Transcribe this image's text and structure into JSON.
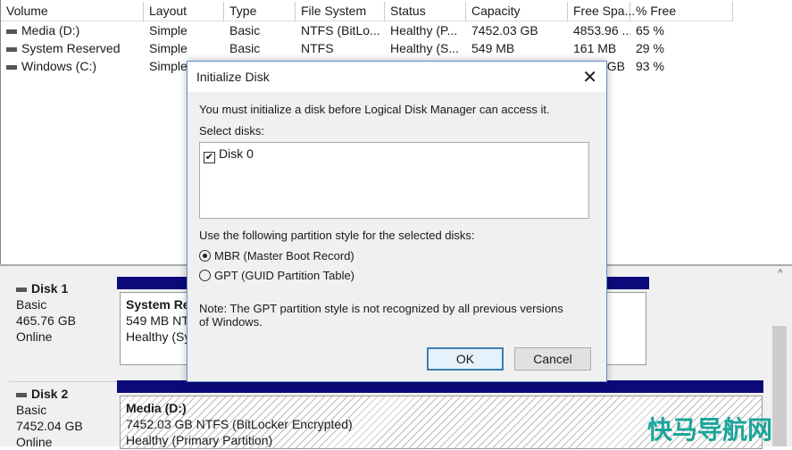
{
  "volumes": {
    "columns": [
      "Volume",
      "Layout",
      "Type",
      "File System",
      "Status",
      "Capacity",
      "Free Spa...",
      "% Free"
    ],
    "rows": [
      {
        "volume": "Media (D:)",
        "layout": "Simple",
        "type": "Basic",
        "fs": "NTFS (BitLo...",
        "status": "Healthy (P...",
        "capacity": "7452.03 GB",
        "free": "4853.96 ...",
        "pct": "65 %"
      },
      {
        "volume": "System Reserved",
        "layout": "Simple",
        "type": "Basic",
        "fs": "NTFS",
        "status": "Healthy (S...",
        "capacity": "549 MB",
        "free": "161 MB",
        "pct": "29 %"
      },
      {
        "volume": "Windows (C:)",
        "layout": "Simple",
        "type": "",
        "fs": "",
        "status": "",
        "capacity": "",
        "free": "GB",
        "pct": "93 %"
      }
    ]
  },
  "disks": [
    {
      "name": "Disk 1",
      "type": "Basic",
      "size": "465.76 GB",
      "state": "Online",
      "partition": {
        "name": "System Re",
        "line2": "549 MB NT",
        "line3": "Healthy (Sy"
      },
      "right_fragment": ")"
    },
    {
      "name": "Disk 2",
      "type": "Basic",
      "size": "7452.04 GB",
      "state": "Online",
      "partition": {
        "name": "Media  (D:)",
        "line2": "7452.03 GB NTFS (BitLocker Encrypted)",
        "line3": "Healthy (Primary Partition)"
      }
    }
  ],
  "dialog": {
    "title": "Initialize Disk",
    "intro": "You must initialize a disk before Logical Disk Manager can access it.",
    "select_label": "Select disks:",
    "disks": [
      {
        "label": "Disk 0",
        "checked": true
      }
    ],
    "style_label": "Use the following partition style for the selected disks:",
    "options": [
      {
        "label": "MBR (Master Boot Record)",
        "selected": true
      },
      {
        "label": "GPT (GUID Partition Table)",
        "selected": false
      }
    ],
    "note": "Note: The GPT partition style is not recognized by all previous versions of Windows.",
    "ok": "OK",
    "cancel": "Cancel"
  },
  "watermark": "快马导航网"
}
